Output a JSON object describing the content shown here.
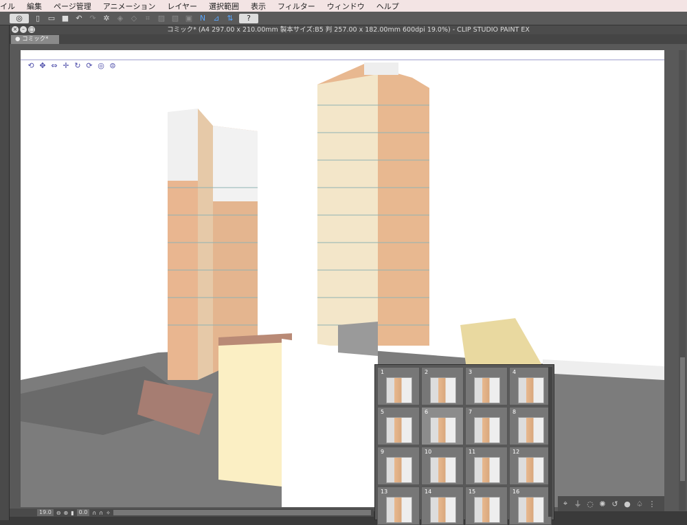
{
  "menu": [
    "イル",
    "編集",
    "ページ管理",
    "アニメーション",
    "レイヤー",
    "選択範囲",
    "表示",
    "フィルター",
    "ウィンドウ",
    "ヘルプ"
  ],
  "window_title": "コミック* (A4 297.00 x 210.00mm 製本サイズ:B5 判 257.00 x 182.00mm 600dpi 19.0%)  - CLIP STUDIO PAINT EX",
  "document_tab": "● コミック*",
  "status": {
    "zoom": "19.0",
    "rotation": "0.0"
  },
  "thumbnails": [
    "1",
    "2",
    "3",
    "4",
    "5",
    "6",
    "7",
    "8",
    "9",
    "10",
    "11",
    "12",
    "13",
    "14",
    "15",
    "16"
  ],
  "selected_thumbnail": "6",
  "colors": {
    "menubar": "#f3e4e4",
    "ui_dark": "#595959",
    "facade": "#e8b98f",
    "ground": "#7a7a7a"
  }
}
